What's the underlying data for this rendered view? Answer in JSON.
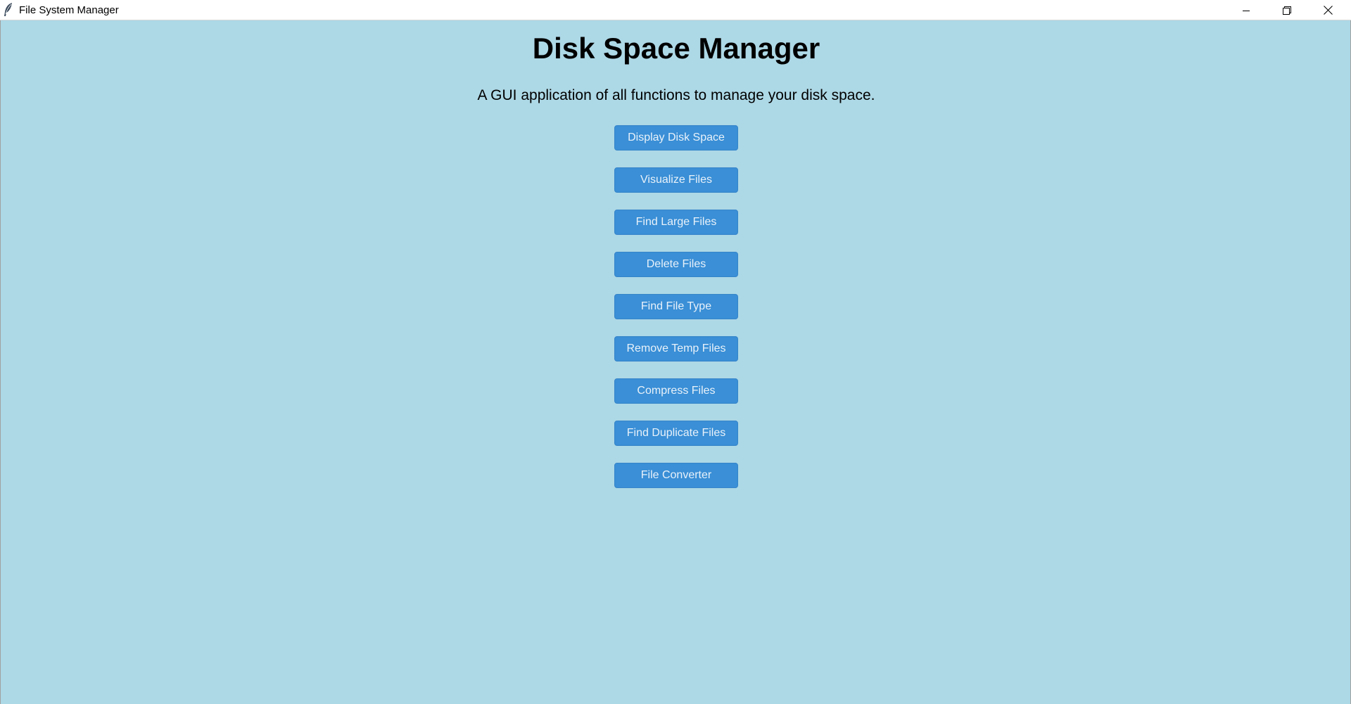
{
  "window": {
    "title": "File System Manager",
    "icon": "feather-icon",
    "controls": {
      "minimize_icon": "minimize-icon",
      "restore_icon": "restore-icon",
      "close_icon": "close-icon"
    }
  },
  "main": {
    "heading": "Disk Space Manager",
    "subtitle": "A GUI application of all functions to manage your disk space.",
    "buttons": [
      {
        "label": "Display Disk Space"
      },
      {
        "label": "Visualize Files"
      },
      {
        "label": "Find Large Files"
      },
      {
        "label": "Delete Files"
      },
      {
        "label": "Find File Type"
      },
      {
        "label": "Remove Temp Files"
      },
      {
        "label": "Compress Files"
      },
      {
        "label": "Find Duplicate Files"
      },
      {
        "label": "File Converter"
      }
    ]
  },
  "colors": {
    "background": "#add8e6",
    "button": "#3a8fd6",
    "button_text": "#e8f1fa",
    "titlebar": "#ffffff"
  }
}
